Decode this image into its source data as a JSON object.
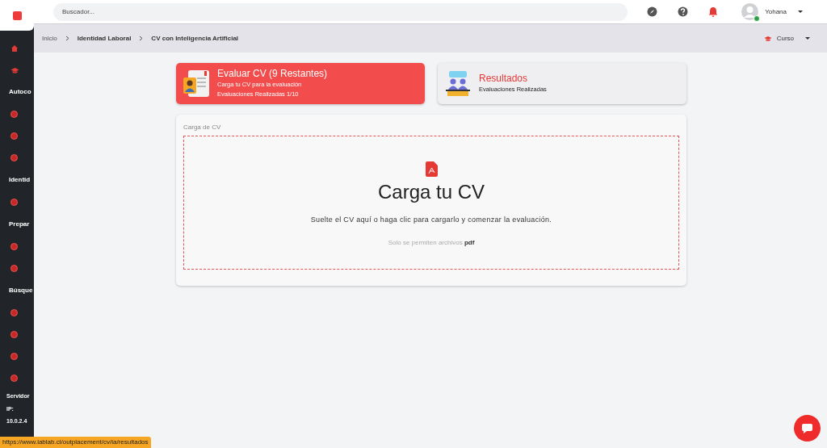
{
  "search": {
    "placeholder": "Buscador..."
  },
  "user": {
    "name": "Yohana",
    "online": true
  },
  "sidebar": {
    "items": [
      {
        "kind": "home"
      },
      {
        "kind": "cap"
      },
      {
        "kind": "section",
        "label": "Autoco"
      },
      {
        "kind": "dot"
      },
      {
        "kind": "dot"
      },
      {
        "kind": "dot"
      },
      {
        "kind": "section",
        "label": "Identid"
      },
      {
        "kind": "dot"
      },
      {
        "kind": "section",
        "label": "Prepar"
      },
      {
        "kind": "dot"
      },
      {
        "kind": "dot"
      },
      {
        "kind": "section",
        "label": "Búsque"
      },
      {
        "kind": "dot"
      },
      {
        "kind": "dot"
      },
      {
        "kind": "dot"
      },
      {
        "kind": "dot"
      }
    ],
    "footer": [
      "Servidor",
      "IP:",
      "10.0.2.4"
    ]
  },
  "breadcrumb": [
    "Inicio",
    "Identidad Laboral",
    "CV con Inteligencia Artificial"
  ],
  "course_menu": "Curso",
  "cards": [
    {
      "kind": "evaluate",
      "selected": true,
      "title": "Evaluar CV (9 Restantes)",
      "lines": [
        "Carga tu CV para la evaluación",
        "Evaluaciones Realizadas 1/10"
      ]
    },
    {
      "kind": "results",
      "selected": false,
      "title": "Resultados",
      "lines": [
        "Evaluaciones Realizadas"
      ]
    }
  ],
  "upload": {
    "panel_title": "Carga de CV",
    "heading": "Carga tu CV",
    "instruction": "Suelte el CV aquí o haga clic para cargarlo y comenzar la evaluación.",
    "note": "Solo se permiten archivos **pdf**"
  },
  "status_url": "https://www.lablab.cl/outplacement/cv/ia/resultados"
}
